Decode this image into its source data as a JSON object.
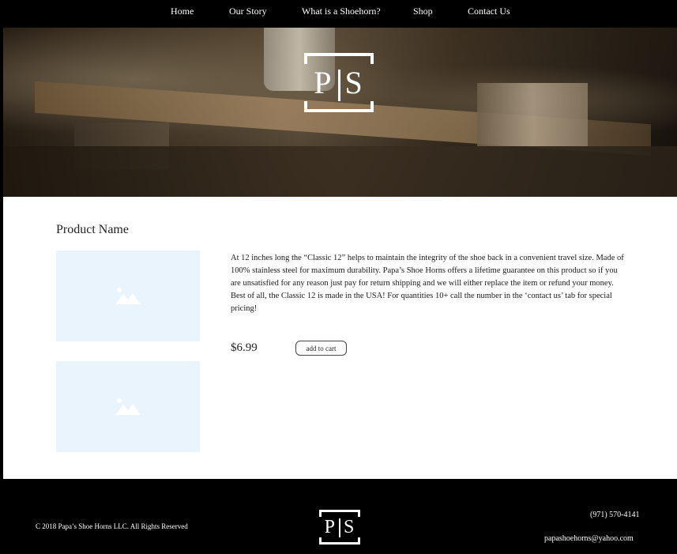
{
  "nav": {
    "items": [
      "Home",
      "Our Story",
      "What is a Shoehorn?",
      "Shop",
      "Contact Us"
    ]
  },
  "logo": {
    "left": "P",
    "right": "S"
  },
  "product": {
    "title": "Product Name",
    "description": "At 12 inches long the “Classic 12” helps to maintain the integrity of the shoe back in a convenient travel size. Made of 100% stainless steel for maximum durability. Papa’s Shoe Horns offers a lifetime guarantee on this product so if you are unsatisfied for any reason just pay for return shipping and we will either replace the item or refund your money. Best of all, the Classic 12 is made in the USA! For quantities 10+ call the number in the ‘contact us’ tab for special pricing!",
    "price": "$6.99",
    "cart_label": "add to cart",
    "image_icon": "image-placeholder-icon"
  },
  "footer": {
    "copyright": "C 2018 Papa’s Shoe Horns LLC. All Rights Reserved",
    "phone": "(971) 570-4141",
    "email": "papashoehorns@yahoo.com"
  },
  "colors": {
    "background": "#000000",
    "content": "#ffffff",
    "placeholder": "#eaf4fd"
  }
}
